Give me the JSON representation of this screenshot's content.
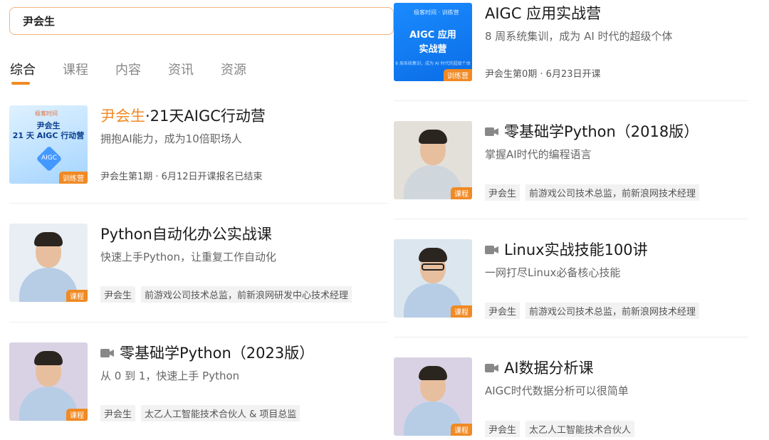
{
  "search": {
    "value": "尹会生"
  },
  "tabs": [
    {
      "label": "综合",
      "active": true
    },
    {
      "label": "课程"
    },
    {
      "label": "内容"
    },
    {
      "label": "资讯"
    },
    {
      "label": "资源"
    }
  ],
  "left_cards": [
    {
      "title_highlight": "尹会生",
      "title_rest": "·21天AIGC行动营",
      "subtitle": "拥抱AI能力，成为10倍职场人",
      "meta": "尹会生第1期 · 6月12日开课报名已结束",
      "badge": "训练营",
      "thumb": {
        "logo": "极客时间",
        "line1": "尹会生",
        "line2": "21 天 AIGC 行动营",
        "cube": "AIGC"
      }
    },
    {
      "title": "Python自动化办公实战课",
      "subtitle": "快速上手Python，让重复工作自动化",
      "tags": [
        "尹会生",
        "前游戏公司技术总监，前新浪网研发中心技术经理"
      ],
      "badge": "课程"
    },
    {
      "title": "零基础学Python（2023版）",
      "subtitle": "从 0 到 1，快速上手 Python",
      "tags": [
        "尹会生",
        "太乙人工智能技术合伙人 & 项目总监"
      ],
      "badge": "课程"
    }
  ],
  "right_cards": [
    {
      "title": "AIGC 应用实战营",
      "subtitle": "8 周系统集训，成为 AI 时代的超级个体",
      "meta": "尹会生第0期 · 6月23日开课",
      "badge": "训练营",
      "thumb": {
        "logo": "极客时间 · 训练营",
        "line1": "AIGC 应用",
        "line2": "实战营",
        "line3": "8 周系统集训，成为 AI 时代的超级个体"
      }
    },
    {
      "title": "零基础学Python（2018版）",
      "subtitle": "掌握AI时代的编程语言",
      "tags": [
        "尹会生",
        "前游戏公司技术总监，前新浪网技术经理"
      ],
      "badge": "课程"
    },
    {
      "title": "Linux实战技能100讲",
      "subtitle": "一网打尽Linux必备核心技能",
      "tags": [
        "尹会生",
        "前游戏公司技术总监，前新浪网技术经理"
      ],
      "badge": "课程"
    },
    {
      "title": "AI数据分析课",
      "subtitle": "AIGC时代数据分析可以很简单",
      "tags": [
        "尹会生",
        "太乙人工智能技术合伙人"
      ],
      "badge": "课程"
    }
  ],
  "colors": {
    "accent": "#f08a24",
    "search_border": "#f1b580"
  },
  "icons": {
    "video": "video-camera-icon"
  }
}
